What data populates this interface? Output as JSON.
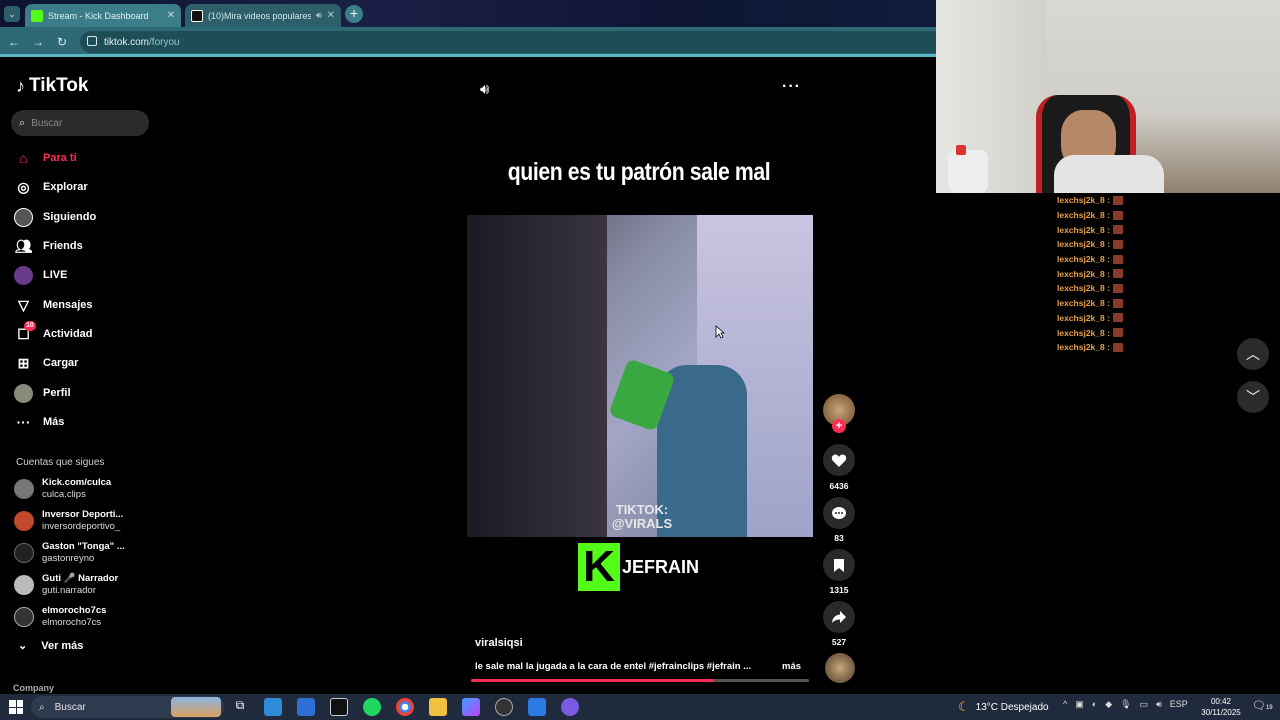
{
  "browser": {
    "tabs": [
      {
        "title": "Stream - Kick Dashboard",
        "favicon": "kick-icon"
      },
      {
        "title": "(10)Mira videos populares",
        "favicon": "tiktok-icon"
      }
    ],
    "url_domain": "tiktok.com",
    "url_path": "/foryou"
  },
  "tiktok": {
    "logo": "TikTok",
    "search_placeholder": "Buscar",
    "nav": [
      {
        "label": "Para ti",
        "icon": "home-icon"
      },
      {
        "label": "Explorar",
        "icon": "compass-icon"
      },
      {
        "label": "Siguiendo",
        "icon": "following-avatar"
      },
      {
        "label": "Friends",
        "icon": "friends-icon"
      },
      {
        "label": "LIVE",
        "icon": "live-avatar"
      },
      {
        "label": "Mensajes",
        "icon": "messages-icon"
      },
      {
        "label": "Actividad",
        "icon": "activity-icon",
        "badge": "10"
      },
      {
        "label": "Cargar",
        "icon": "upload-icon"
      },
      {
        "label": "Perfil",
        "icon": "profile-avatar"
      },
      {
        "label": "Más",
        "icon": "more-icon"
      }
    ],
    "following_header": "Cuentas que sigues",
    "following": [
      {
        "name": "Kick.com/culca",
        "handle": "culca.clips"
      },
      {
        "name": "Inversor Deporti...",
        "handle": "inversordeportivo_"
      },
      {
        "name": "Gaston \"Tonga\" ...",
        "handle": "gastonreyno"
      },
      {
        "name": "Guti 🎤 Narrador",
        "handle": "guti.narrador"
      },
      {
        "name": "elmorocho7cs",
        "handle": "elmorocho7cs"
      }
    ],
    "see_more": "Ver más",
    "company": "Company"
  },
  "video": {
    "overlay_text": "quien es tu patrón sale mal",
    "watermark": "TIKTOK:\n@VIRALS",
    "streamer_name": "JEFRAIN",
    "author": "viralsiqsi",
    "description": "le sale mal la jugada a la cara de entel #jefrainclips #jefrain ...",
    "more_label": "más",
    "progress": 0.72,
    "likes": "6436",
    "comments": "83",
    "saves": "1315",
    "shares": "527"
  },
  "chat": {
    "user": "lexchsj2k_8 :",
    "lines": 11
  },
  "taskbar": {
    "search": "Buscar",
    "weather": "13°C  Despejado",
    "lang": "ESP",
    "time": "00:42",
    "date": "30/11/2025",
    "notif": "19"
  },
  "colors": {
    "tiktok_red": "#fe2c55",
    "kick_green": "#53fc18",
    "chat_name": "#e8a04b"
  }
}
